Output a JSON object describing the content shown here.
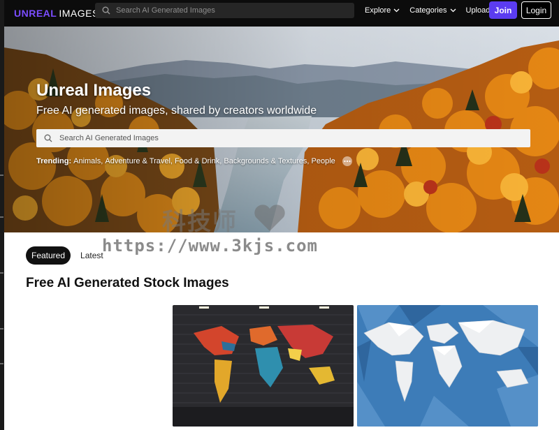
{
  "logo": {
    "part1": "UNREAL",
    "part2": "IMAGES"
  },
  "top_search": {
    "placeholder": "Search AI Generated Images"
  },
  "nav": {
    "explore": "Explore",
    "categories": "Categories",
    "upload": "Upload",
    "join": "Join",
    "login": "Login"
  },
  "hero": {
    "title": "Unreal Images",
    "subtitle": "Free AI generated images, shared by creators worldwide",
    "search_placeholder": "Search AI Generated Images",
    "trending_label": "Trending:",
    "trending": [
      "Animals",
      "Adventure & Travel",
      "Food & Drink",
      "Backgrounds & Textures",
      "People"
    ]
  },
  "watermark": {
    "line1": "科技师",
    "line2": "https://www.3kjs.com"
  },
  "tabs": [
    "Featured",
    "Latest"
  ],
  "active_tab": "Featured",
  "section_title": "Free AI Generated Stock Images",
  "images": [
    {
      "name": "colorful-world-map-on-brick-wall"
    },
    {
      "name": "white-low-poly-world-map-on-blue"
    }
  ],
  "colors": {
    "accent": "#5b3cf0",
    "logo_accent": "#7b4dff",
    "topbar": "#0c0c0c"
  }
}
